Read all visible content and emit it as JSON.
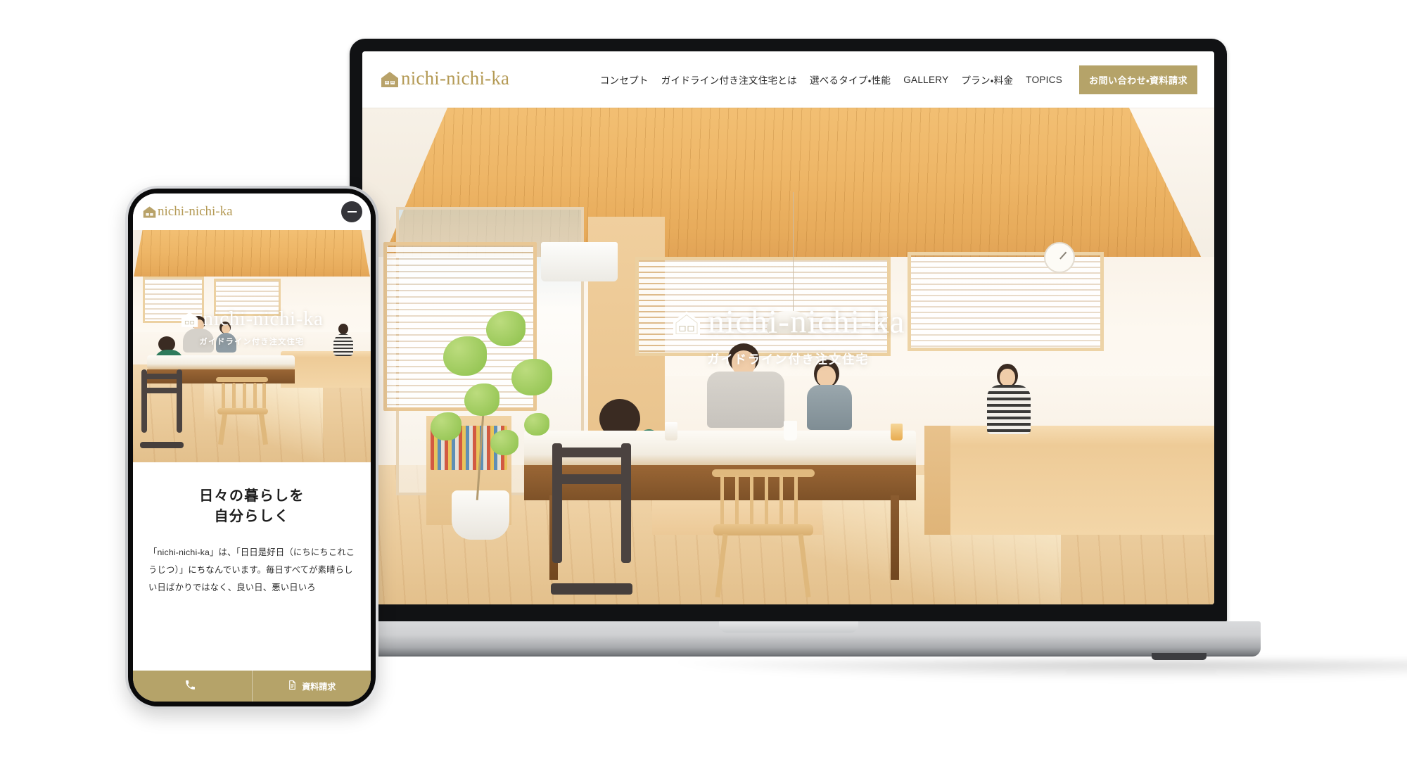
{
  "brand": {
    "name": "nichi-nichi-ka",
    "logo_icon": "house-icon",
    "accent_color": "#b5a369",
    "logo_text_color": "#b49a55"
  },
  "desktop": {
    "header": {
      "nav_items": [
        {
          "label": "コンセプト"
        },
        {
          "label": "ガイドライン付き注文住宅とは"
        },
        {
          "label": "選べるタイプ・性能"
        },
        {
          "label": "GALLERY"
        },
        {
          "label": "プラン・料金"
        },
        {
          "label": "TOPICS"
        }
      ],
      "cta_label": "お問い合わせ・資料請求"
    },
    "hero": {
      "title": "nichi-nichi-ka",
      "subtitle": "ガイドライン付き注文住宅",
      "logo_icon": "house-icon",
      "photo_alt": "木の天井のダイニングで食卓を囲む家族"
    }
  },
  "mobile": {
    "header": {
      "brand_label": "nichi-nichi-ka",
      "menu_icon": "hamburger-icon"
    },
    "hero": {
      "title": "nichi-nichi-ka",
      "subtitle": "ガイドライン付き注文住宅"
    },
    "content": {
      "heading_line1": "日々の暮らしを",
      "heading_line2": "自分らしく",
      "paragraph": "「nichi-nichi-ka」は、「日日是好日（にちにちこれこうじつ）」にちなんでいます。毎日すべてが素晴らしい日ばかりではなく、良い日、悪い日いろ"
    },
    "bottom_bar": [
      {
        "icon": "phone-icon",
        "label": ""
      },
      {
        "icon": "document-icon",
        "label": "資料請求"
      }
    ]
  },
  "devices": {
    "laptop_label": "laptop-mockup",
    "phone_label": "phone-mockup"
  }
}
